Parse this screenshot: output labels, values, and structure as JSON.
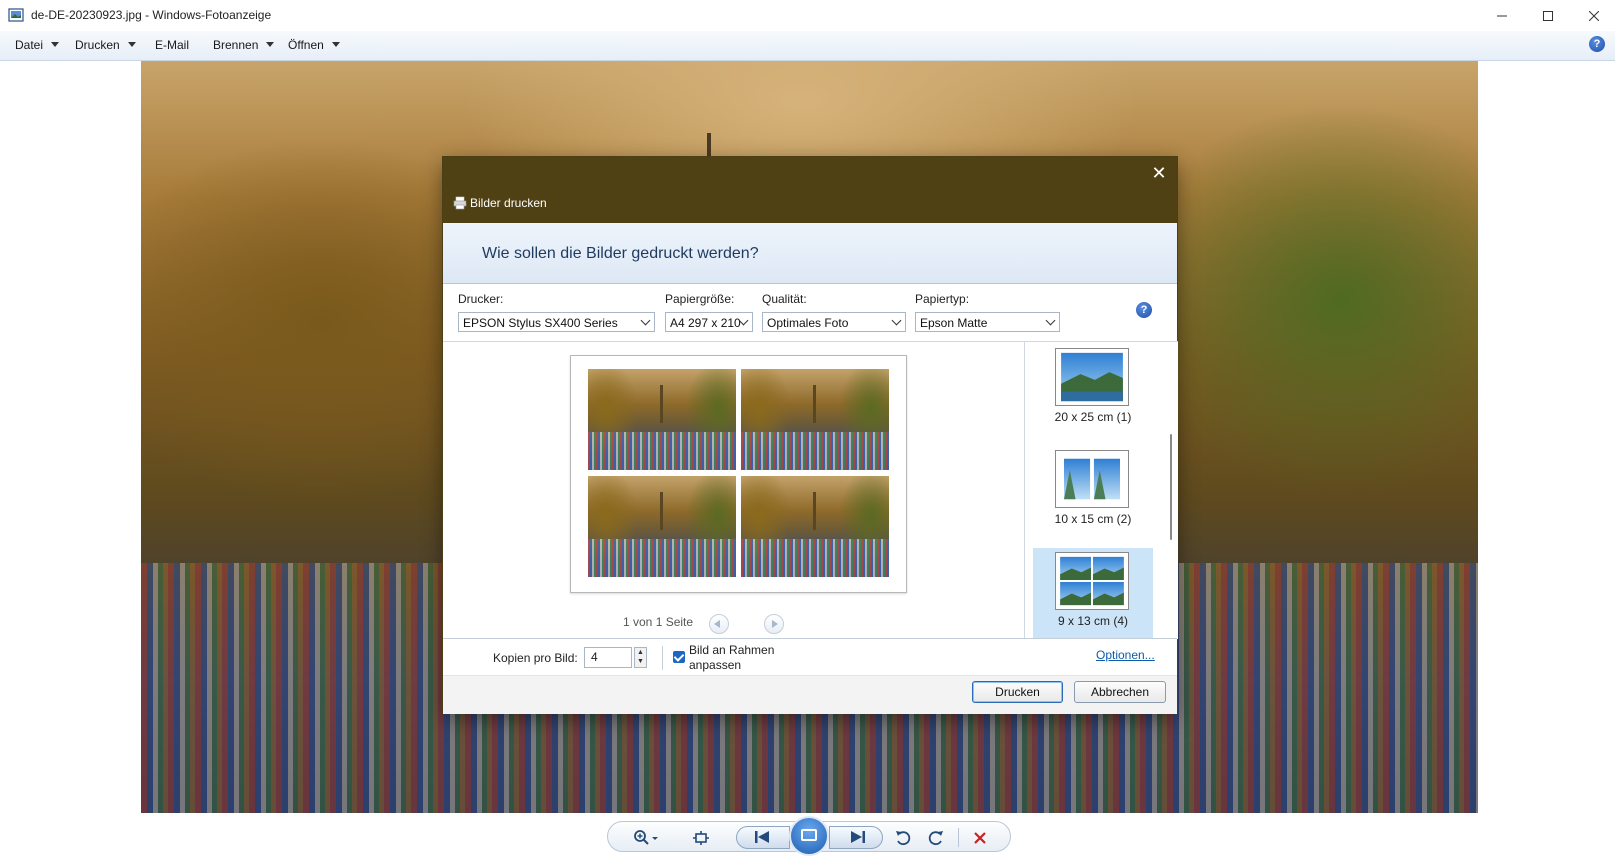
{
  "window": {
    "title": "de-DE-20230923.jpg - Windows-Fotoanzeige",
    "minimize_icon": "minimize-icon",
    "maximize_icon": "maximize-icon",
    "close_icon": "close-icon"
  },
  "menu": {
    "items": [
      {
        "label": "Datei",
        "has_dropdown": true
      },
      {
        "label": "Drucken",
        "has_dropdown": true
      },
      {
        "label": "E-Mail",
        "has_dropdown": false
      },
      {
        "label": "Brennen",
        "has_dropdown": true
      },
      {
        "label": "Öffnen",
        "has_dropdown": true
      }
    ],
    "help_glyph": "?"
  },
  "dialog": {
    "title": "Bilder drucken",
    "heading": "Wie sollen die Bilder gedruckt werden?",
    "close_glyph": "✕",
    "help_glyph": "?",
    "printer": {
      "label": "Drucker:",
      "value": "EPSON Stylus SX400 Series"
    },
    "paper_size": {
      "label": "Papiergröße:",
      "value": "A4 297 x 210"
    },
    "quality": {
      "label": "Qualität:",
      "value": "Optimales Foto"
    },
    "paper_type": {
      "label": "Papiertyp:",
      "value": "Epson Matte"
    },
    "page_info": "1 von 1 Seite",
    "layouts": [
      {
        "label": "20 x 25 cm (1)",
        "selected": false
      },
      {
        "label": "10 x 15 cm (2)",
        "selected": false
      },
      {
        "label": "9 x 13 cm (4)",
        "selected": true
      }
    ],
    "copies_label": "Kopien pro Bild:",
    "copies_value": "4",
    "fit_label": "Bild an Rahmen anpassen",
    "fit_checked": true,
    "options_link": "Optionen...",
    "print_button": "Drucken",
    "cancel_button": "Abbrechen"
  },
  "colors": {
    "dialog_title_bg": "#4f4114",
    "selection": "#cce4f7",
    "link": "#0b5cad",
    "checkbox": "#1a67c4"
  },
  "toolbar": {
    "icons": [
      "zoom-icon",
      "fit-window-icon",
      "previous-icon",
      "slideshow-icon",
      "next-icon",
      "rotate-left-icon",
      "rotate-right-icon",
      "delete-icon"
    ]
  }
}
